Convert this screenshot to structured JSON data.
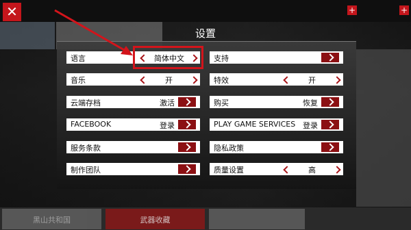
{
  "dialog": {
    "title": "设置"
  },
  "settings": {
    "left": [
      {
        "label": "语言",
        "value": "简体中文",
        "control": "selector"
      },
      {
        "label": "音乐",
        "value": "开",
        "control": "selector"
      },
      {
        "label": "云端存档",
        "value": "激活",
        "control": "button"
      },
      {
        "label": "FACEBOOK",
        "value": "登录",
        "control": "button"
      },
      {
        "label": "服务条款",
        "value": "",
        "control": "button"
      },
      {
        "label": "制作团队",
        "value": "",
        "control": "button"
      }
    ],
    "right": [
      {
        "label": "支持",
        "value": "",
        "control": "button"
      },
      {
        "label": "特效",
        "value": "开",
        "control": "selector"
      },
      {
        "label": "购买",
        "value": "恢复",
        "control": "button"
      },
      {
        "label": "PLAY GAME SERVICES",
        "value": "登录",
        "control": "button"
      },
      {
        "label": "隐私政策",
        "value": "",
        "control": "button"
      },
      {
        "label": "质量设置",
        "value": "高",
        "control": "selector"
      }
    ]
  },
  "background_tabs": [
    "黑山共和国",
    "武器收藏",
    ""
  ],
  "colors": {
    "accent": "#c4161c",
    "button": "#8b1013",
    "row": "#ffffff"
  },
  "icons": {
    "close": "close-icon",
    "plus": "plus-icon"
  }
}
